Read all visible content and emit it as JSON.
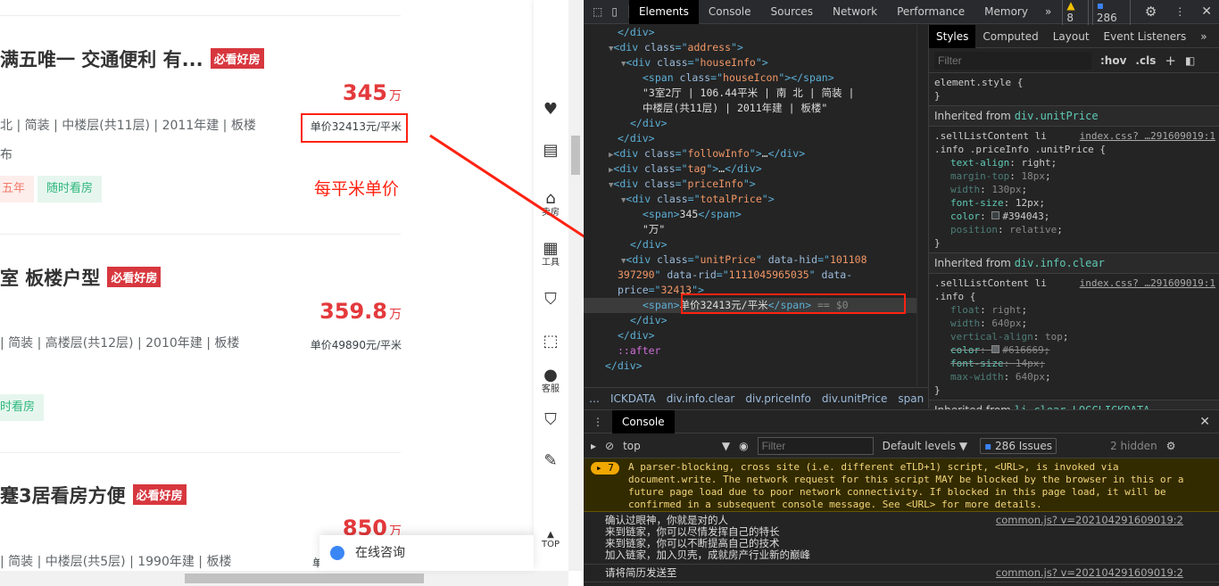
{
  "listings": [
    {
      "title": "满五唯一 交通便利 有...",
      "badge": "必看好房",
      "price": "345",
      "unit": "万",
      "info": "北 | 简装 | 中楼层(共11层) | 2011年建 | 板楼",
      "follow": "布",
      "unit_price": "单价32413元/平米",
      "tags": [
        "五年",
        "随时看房"
      ]
    },
    {
      "title": "室 板楼户型",
      "badge": "必看好房",
      "price": "359.8",
      "unit": "万",
      "info": "| 简装 | 高楼层(共12层) | 2010年建 | 板楼",
      "unit_price": "单价49890元/平米",
      "tags": [
        "时看房"
      ]
    },
    {
      "title": "蹇3居看房方便",
      "badge": "必看好房",
      "price": "850",
      "unit": "万",
      "info": "| 简装 | 中楼层(共5层) | 1990年建 | 板楼",
      "unit_price": "单价"
    }
  ],
  "annotation": "每平米单价",
  "annotation_color": "#ff2211",
  "sidebar": [
    {
      "icon": "heart-icon",
      "label": ""
    },
    {
      "icon": "compare-icon",
      "label": ""
    },
    {
      "icon": "sell-house-icon",
      "label": "卖房"
    },
    {
      "icon": "tools-icon",
      "label": "工具"
    },
    {
      "icon": "promise-icon",
      "label": ""
    },
    {
      "icon": "scan-icon",
      "label": ""
    },
    {
      "icon": "customer-service-icon",
      "label": "客服"
    },
    {
      "icon": "phone-shield-icon",
      "label": ""
    },
    {
      "icon": "edit-icon",
      "label": ""
    },
    {
      "icon": "back-to-top-icon",
      "label": "TOP"
    }
  ],
  "chat": {
    "label": "在线咨询"
  },
  "devtools": {
    "tabs": [
      "Elements",
      "Console",
      "Sources",
      "Network",
      "Performance",
      "Memory"
    ],
    "active_tab": "Elements",
    "warnings": "8",
    "issues": "286",
    "dom": [
      {
        "d": 3,
        "s": [
          [
            "t",
            "</div>"
          ]
        ]
      },
      {
        "d": 3,
        "arrow": "▼",
        "s": [
          [
            "t",
            "<div "
          ],
          [
            "a",
            "class"
          ],
          [
            "t",
            "=\""
          ],
          [
            "v",
            "address"
          ],
          [
            "t",
            "\">"
          ]
        ]
      },
      {
        "d": 4,
        "arrow": "▼",
        "s": [
          [
            "t",
            "<div "
          ],
          [
            "a",
            "class"
          ],
          [
            "t",
            "=\""
          ],
          [
            "v",
            "houseInfo"
          ],
          [
            "t",
            "\">"
          ]
        ]
      },
      {
        "d": 5,
        "s": [
          [
            "t",
            "<span "
          ],
          [
            "a",
            "class"
          ],
          [
            "t",
            "=\""
          ],
          [
            "v",
            "houseIcon"
          ],
          [
            "t",
            "\"></span>"
          ]
        ]
      },
      {
        "d": 5,
        "s": [
          [
            "x",
            "\"3室2厅 | 106.44平米 | 南 北 | 简装 |"
          ]
        ]
      },
      {
        "d": 5,
        "s": [
          [
            "x",
            "中楼层(共11层) | 2011年建 | 板楼\""
          ]
        ]
      },
      {
        "d": 4,
        "s": [
          [
            "t",
            "</div>"
          ]
        ]
      },
      {
        "d": 3,
        "s": [
          [
            "t",
            "</div>"
          ]
        ]
      },
      {
        "d": 3,
        "arrow": "▶",
        "s": [
          [
            "t",
            "<div "
          ],
          [
            "a",
            "class"
          ],
          [
            "t",
            "=\""
          ],
          [
            "v",
            "followInfo"
          ],
          [
            "t",
            "\">"
          ],
          [
            "x",
            "…"
          ],
          [
            "t",
            "</div>"
          ]
        ]
      },
      {
        "d": 3,
        "arrow": "▶",
        "s": [
          [
            "t",
            "<div "
          ],
          [
            "a",
            "class"
          ],
          [
            "t",
            "=\""
          ],
          [
            "v",
            "tag"
          ],
          [
            "t",
            "\">"
          ],
          [
            "x",
            "…"
          ],
          [
            "t",
            "</div>"
          ]
        ]
      },
      {
        "d": 3,
        "arrow": "▼",
        "s": [
          [
            "t",
            "<div "
          ],
          [
            "a",
            "class"
          ],
          [
            "t",
            "=\""
          ],
          [
            "v",
            "priceInfo"
          ],
          [
            "t",
            "\">"
          ]
        ]
      },
      {
        "d": 4,
        "arrow": "▼",
        "s": [
          [
            "t",
            "<div "
          ],
          [
            "a",
            "class"
          ],
          [
            "t",
            "=\""
          ],
          [
            "v",
            "totalPrice"
          ],
          [
            "t",
            "\">"
          ]
        ]
      },
      {
        "d": 5,
        "s": [
          [
            "t",
            "<span>"
          ],
          [
            "x",
            "345"
          ],
          [
            "t",
            "</span>"
          ]
        ]
      },
      {
        "d": 5,
        "s": [
          [
            "x",
            "\"万\""
          ]
        ]
      },
      {
        "d": 4,
        "s": [
          [
            "t",
            "</div>"
          ]
        ]
      },
      {
        "d": 4,
        "arrow": "▼",
        "s": [
          [
            "t",
            "<div "
          ],
          [
            "a",
            "class"
          ],
          [
            "t",
            "=\""
          ],
          [
            "v",
            "unitPrice"
          ],
          [
            "t",
            "\" "
          ],
          [
            "a",
            "data-hid"
          ],
          [
            "t",
            "=\""
          ],
          [
            "v",
            "101108"
          ]
        ]
      },
      {
        "d": 3,
        "s": [
          [
            "v",
            "397290"
          ],
          [
            "t",
            "\" "
          ],
          [
            "a",
            "data-rid"
          ],
          [
            "t",
            "=\""
          ],
          [
            "v",
            "1111045965035"
          ],
          [
            "t",
            "\" "
          ],
          [
            "a",
            "data-"
          ]
        ]
      },
      {
        "d": 3,
        "s": [
          [
            "a",
            "price"
          ],
          [
            "t",
            "=\""
          ],
          [
            "v",
            "32413"
          ],
          [
            "t",
            "\">"
          ]
        ]
      },
      {
        "d": 5,
        "sel": true,
        "s": [
          [
            "t",
            "<span>"
          ],
          [
            "x",
            "单价32413元/平米"
          ],
          [
            "t",
            "</span>"
          ],
          [
            "g",
            " == $0"
          ]
        ]
      },
      {
        "d": 4,
        "s": [
          [
            "t",
            "</div>"
          ]
        ]
      },
      {
        "d": 3,
        "s": [
          [
            "t",
            "</div>"
          ]
        ]
      },
      {
        "d": 3,
        "s": [
          [
            "p",
            "::after"
          ]
        ]
      },
      {
        "d": 2,
        "s": [
          [
            "t",
            "</div>"
          ]
        ]
      }
    ],
    "breadcrumbs": [
      "…",
      "ICKDATA",
      "div.info.clear",
      "div.priceInfo",
      "div.unitPrice",
      "span",
      "…"
    ],
    "styles_tabs": [
      "Styles",
      "Computed",
      "Layout",
      "Event Listeners"
    ],
    "filter_placeholder": "Filter",
    "hov": ":hov",
    "cls": ".cls",
    "element_style": "element.style {",
    "inherited": [
      {
        "label": "Inherited from",
        "from": "div.unitPrice",
        "selector": ".sellListContent li\n.info .priceInfo .unitPrice {",
        "src": "index.css? …291609019:1",
        "props": [
          [
            "text-align",
            "right",
            ""
          ],
          [
            "margin-top",
            "18px",
            "dim"
          ],
          [
            "width",
            "130px",
            "dim"
          ],
          [
            "font-size",
            "12px",
            ""
          ],
          [
            "color",
            "#394043",
            ""
          ],
          [
            "position",
            "relative",
            "dim"
          ]
        ]
      },
      {
        "label": "Inherited from",
        "from": "div.info.clear",
        "selector": ".sellListContent li\n.info {",
        "src": "index.css? …291609019:1",
        "props": [
          [
            "float",
            "right",
            "dim"
          ],
          [
            "width",
            "640px",
            "dim"
          ],
          [
            "vertical-align",
            "top",
            "dim"
          ],
          [
            "color",
            "#616669",
            "strike"
          ],
          [
            "font-size",
            "14px",
            "strike"
          ],
          [
            "max-width",
            "640px",
            "dim"
          ]
        ]
      },
      {
        "label": "Inherited from",
        "from": "li.clear.LOGCLICKDATA"
      }
    ],
    "console": {
      "tab": "Console",
      "context": "top",
      "filter_placeholder": "Filter",
      "levels": "Default levels ▼",
      "issues": "286 Issues",
      "hidden": "2 hidden",
      "warning_count": "7",
      "warning": "A parser-blocking, cross site (i.e. different eTLD+1) script, <URL>, is invoked via document.write. The network request for this script MAY be blocked by the browser in this or a future page load due to poor network connectivity. If blocked in this page load, it will be confirmed in a subsequent console message. See <URL> for more details.",
      "messages": [
        {
          "lines": [
            "确认过眼神，你就是对的人",
            "来到链家，你可以尽情发挥自己的特长",
            "来到链家，你可以不断提高自己的技术",
            "加入链家，加入贝壳，成就房产行业新的巅峰"
          ],
          "src": "common.js? v=202104291609019:2"
        },
        {
          "lines": [
            "请将简历发送至"
          ],
          "src": "common.js? v=202104291609019:2"
        }
      ]
    }
  }
}
